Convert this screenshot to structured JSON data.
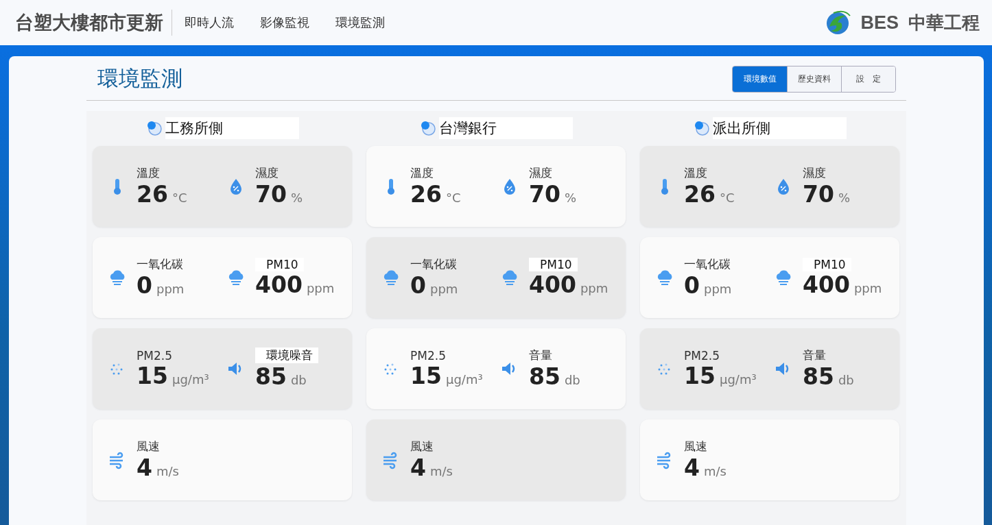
{
  "header": {
    "title": "台塑大樓都市更新",
    "nav": [
      {
        "label": "即時人流",
        "selected": false
      },
      {
        "label": "影像監視",
        "selected": false
      },
      {
        "label": "環境監測",
        "selected": false
      }
    ],
    "brand": {
      "short": "BES",
      "name": "中華工程"
    }
  },
  "page": {
    "title": "環境監測",
    "tabs": [
      {
        "label": "環境數值",
        "selected": true
      },
      {
        "label": "歷史資料",
        "selected": false
      },
      {
        "label": "設　定",
        "selected": false
      }
    ]
  },
  "stations": [
    {
      "name": "工務所側",
      "cards": [
        [
          {
            "kind": "temperature",
            "label": "溫度",
            "value": "26",
            "unit": "°C",
            "highlighted": false
          },
          {
            "kind": "humidity",
            "label": "濕度",
            "value": "70",
            "unit": "%",
            "highlighted": false
          }
        ],
        [
          {
            "kind": "cloud",
            "label": "一氧化碳",
            "value": "0",
            "unit": "ppm",
            "highlighted": false
          },
          {
            "kind": "cloud",
            "label": "PM10",
            "value": "400",
            "unit": "ppm",
            "highlighted": true
          }
        ],
        [
          {
            "kind": "dust",
            "label": "PM2.5",
            "value": "15",
            "unit": "μg/m³",
            "highlighted": false
          },
          {
            "kind": "speaker",
            "label": "環境噪音",
            "value": "85",
            "unit": "db",
            "highlighted": true
          }
        ],
        [
          {
            "kind": "wind",
            "label": "風速",
            "value": "4",
            "unit": "m/s",
            "highlighted": false
          }
        ]
      ]
    },
    {
      "name": "台灣銀行",
      "cards": [
        [
          {
            "kind": "temperature",
            "label": "溫度",
            "value": "26",
            "unit": "°C",
            "highlighted": false
          },
          {
            "kind": "humidity",
            "label": "濕度",
            "value": "70",
            "unit": "%",
            "highlighted": false
          }
        ],
        [
          {
            "kind": "cloud",
            "label": "一氧化碳",
            "value": "0",
            "unit": "ppm",
            "highlighted": false
          },
          {
            "kind": "cloud",
            "label": "PM10",
            "value": "400",
            "unit": "ppm",
            "highlighted": true
          }
        ],
        [
          {
            "kind": "dust",
            "label": "PM2.5",
            "value": "15",
            "unit": "μg/m³",
            "highlighted": false
          },
          {
            "kind": "speaker",
            "label": "音量",
            "value": "85",
            "unit": "db",
            "highlighted": false
          }
        ],
        [
          {
            "kind": "wind",
            "label": "風速",
            "value": "4",
            "unit": "m/s",
            "highlighted": false
          }
        ]
      ]
    },
    {
      "name": "派出所側",
      "cards": [
        [
          {
            "kind": "temperature",
            "label": "溫度",
            "value": "26",
            "unit": "°C",
            "highlighted": false
          },
          {
            "kind": "humidity",
            "label": "濕度",
            "value": "70",
            "unit": "%",
            "highlighted": false
          }
        ],
        [
          {
            "kind": "cloud",
            "label": "一氧化碳",
            "value": "0",
            "unit": "ppm",
            "highlighted": false
          },
          {
            "kind": "cloud",
            "label": "PM10",
            "value": "400",
            "unit": "ppm",
            "highlighted": true
          }
        ],
        [
          {
            "kind": "dust",
            "label": "PM2.5",
            "value": "15",
            "unit": "μg/m³",
            "highlighted": false
          },
          {
            "kind": "speaker",
            "label": "音量",
            "value": "85",
            "unit": "db",
            "highlighted": false
          }
        ],
        [
          {
            "kind": "wind",
            "label": "風速",
            "value": "4",
            "unit": "m/s",
            "highlighted": false
          }
        ]
      ]
    }
  ]
}
